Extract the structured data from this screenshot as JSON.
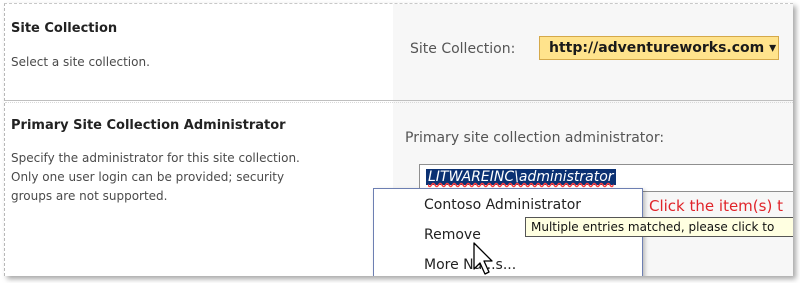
{
  "site_collection": {
    "title": "Site Collection",
    "description": "Select a site collection.",
    "field_label": "Site Collection:",
    "selected_value": "http://adventureworks.com",
    "dropdown_arrow": "▾"
  },
  "admin": {
    "title": "Primary Site Collection Administrator",
    "description_lines": [
      "Specify the administrator for this site collection.",
      "Only one user login can be provided; security",
      "groups are not supported."
    ],
    "field_label": "Primary site collection administrator:",
    "input_value": "LITWAREINC\\administrator",
    "error_text": "Click the item(s) t"
  },
  "context_menu": {
    "items": [
      "Contoso Administrator",
      "Remove",
      "More Na...s..."
    ]
  },
  "tooltip": "Multiple entries matched, please click to",
  "colors": {
    "select_bg": "#ffe38c",
    "selected_text_bg": "#0b3173",
    "error": "#e0242a",
    "tooltip_bg": "#ffffe1"
  },
  "icons": {
    "cursor": "pointer-cursor-icon"
  }
}
